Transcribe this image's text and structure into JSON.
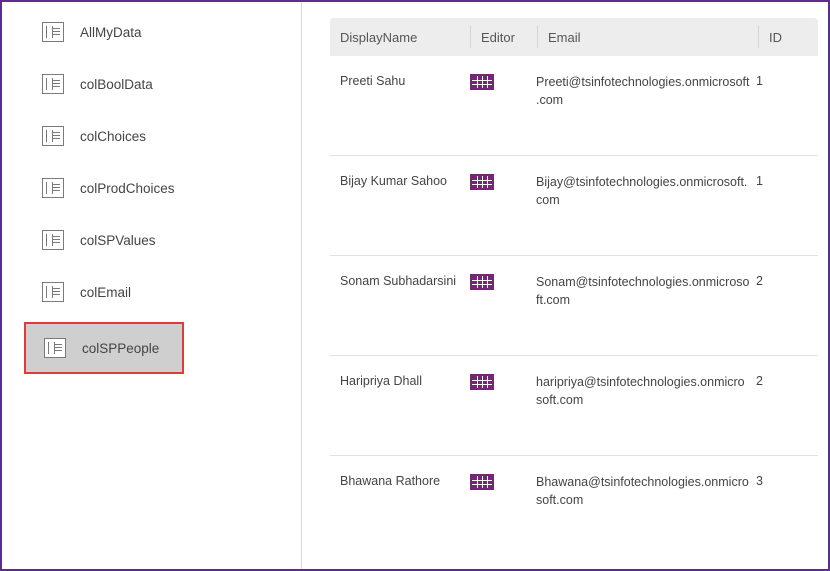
{
  "sidebar": {
    "items": [
      {
        "label": "AllMyData"
      },
      {
        "label": "colBoolData"
      },
      {
        "label": "colChoices"
      },
      {
        "label": "colProdChoices"
      },
      {
        "label": "colSPValues"
      },
      {
        "label": "colEmail"
      },
      {
        "label": "colSPPeople",
        "selected": true,
        "highlighted": true
      }
    ]
  },
  "table": {
    "headers": {
      "displayName": "DisplayName",
      "editor": "Editor",
      "email": "Email",
      "id": "ID"
    },
    "rows": [
      {
        "displayName": "Preeti Sahu",
        "email": "Preeti@tsinfotechnologies.onmicrosoft.com",
        "id": "1"
      },
      {
        "displayName": "Bijay Kumar Sahoo",
        "email": "Bijay@tsinfotechnologies.onmicrosoft.com",
        "id": "1"
      },
      {
        "displayName": "Sonam Subhadarsini",
        "email": "Sonam@tsinfotechnologies.onmicrosoft.com",
        "id": "2"
      },
      {
        "displayName": "Haripriya Dhall",
        "email": "haripriya@tsinfotechnologies.onmicrosoft.com",
        "id": "2"
      },
      {
        "displayName": "Bhawana Rathore",
        "email": "Bhawana@tsinfotechnologies.onmicrosoft.com",
        "id": "3"
      }
    ]
  }
}
